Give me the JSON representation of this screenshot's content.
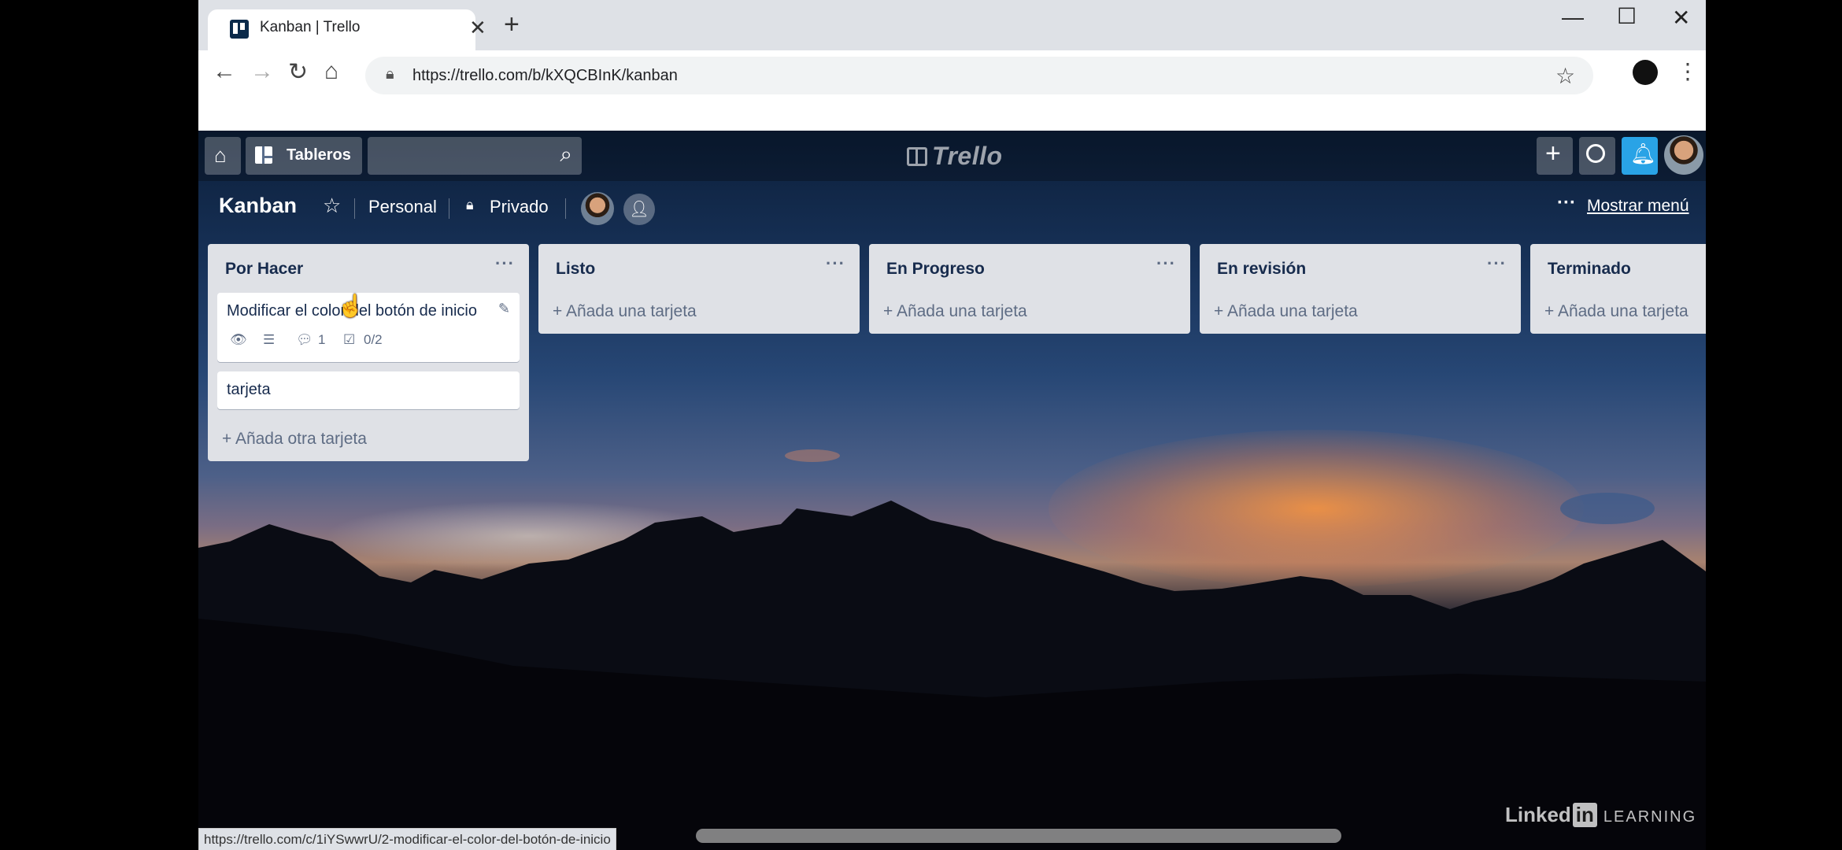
{
  "browser": {
    "tab_title": "Kanban | Trello",
    "tab_close": "✕",
    "new_tab": "+",
    "minimize": "—",
    "maximize": "☐",
    "close": "✕",
    "url": "https://trello.com/b/kXQCBInK/kanban",
    "status_url": "https://trello.com/c/1iYSwwrU/2-modificar-el-color-del-botón-de-inicio"
  },
  "topbar": {
    "boards_label": "Tableros",
    "logo_text": "Trello"
  },
  "board": {
    "title": "Kanban",
    "team": "Personal",
    "visibility": "Privado",
    "show_menu": "Mostrar menú"
  },
  "lists": [
    {
      "title": "Por Hacer",
      "cards": [
        {
          "title": "Modificar el color del botón de inicio",
          "comments": "1",
          "checklist": "0/2"
        },
        {
          "title": "tarjeta"
        }
      ],
      "add_label": "+ Añada otra tarjeta"
    },
    {
      "title": "Listo",
      "add_label": "+ Añada una tarjeta"
    },
    {
      "title": "En Progreso",
      "add_label": "+ Añada una tarjeta"
    },
    {
      "title": "En revisión",
      "add_label": "+ Añada una tarjeta"
    },
    {
      "title": "Terminado",
      "add_label": "+ Añada una tarjeta"
    }
  ],
  "watermark": {
    "brand": "Linked",
    "in": "in",
    "learning": "LEARNING"
  },
  "colors": {
    "bell": "#29a3e6",
    "list_bg": "#dfe1e6",
    "text_dark": "#172b4d"
  }
}
